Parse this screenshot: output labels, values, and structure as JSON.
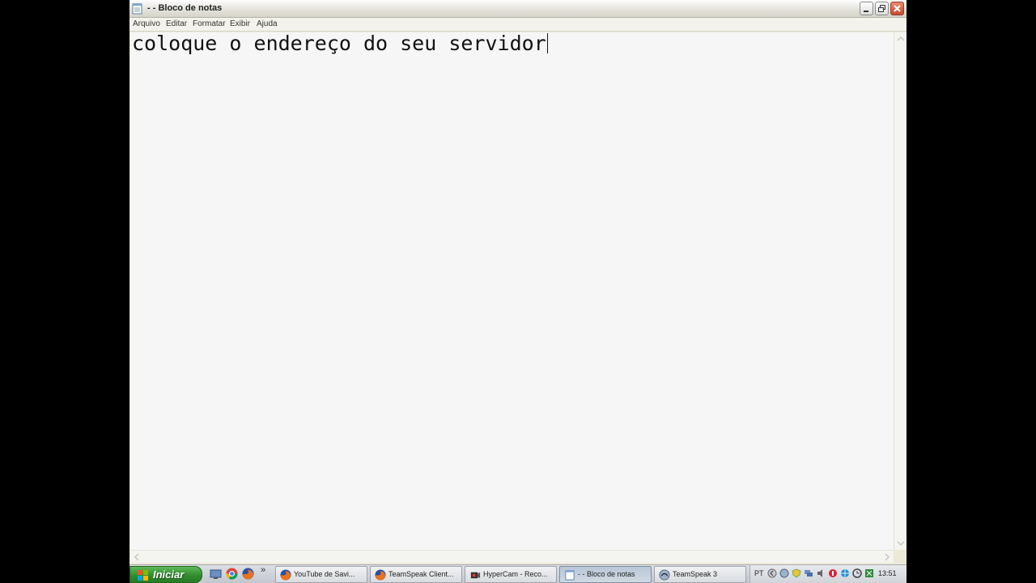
{
  "window": {
    "title": "- - Bloco de notas",
    "menu": [
      "Arquivo",
      "Editar",
      "Formatar",
      "Exibir",
      "Ajuda"
    ]
  },
  "editor": {
    "text": "coloque o endereço do seu servidor"
  },
  "taskbar": {
    "start_label": "Iniciar",
    "quick_launch": [
      "show-desktop-icon",
      "chrome-icon",
      "firefox-icon"
    ],
    "more_indicator": "»",
    "tasks": [
      {
        "label": "YouTube de Savi...",
        "icon": "firefox-icon",
        "active": false
      },
      {
        "label": "TeamSpeak Client...",
        "icon": "firefox-icon",
        "active": false
      },
      {
        "label": "HyperCam - Reco...",
        "icon": "hypercam-icon",
        "active": false
      },
      {
        "label": "- - Bloco de notas",
        "icon": "notepad-icon",
        "active": true
      },
      {
        "label": "TeamSpeak 3",
        "icon": "teamspeak-icon",
        "active": false
      }
    ],
    "tray": {
      "language": "PT",
      "clock": "13:51"
    }
  },
  "colors": {
    "start_green": "#2f8a2c",
    "close_red": "#c44a2f",
    "editor_bg": "#f6f6f6"
  }
}
